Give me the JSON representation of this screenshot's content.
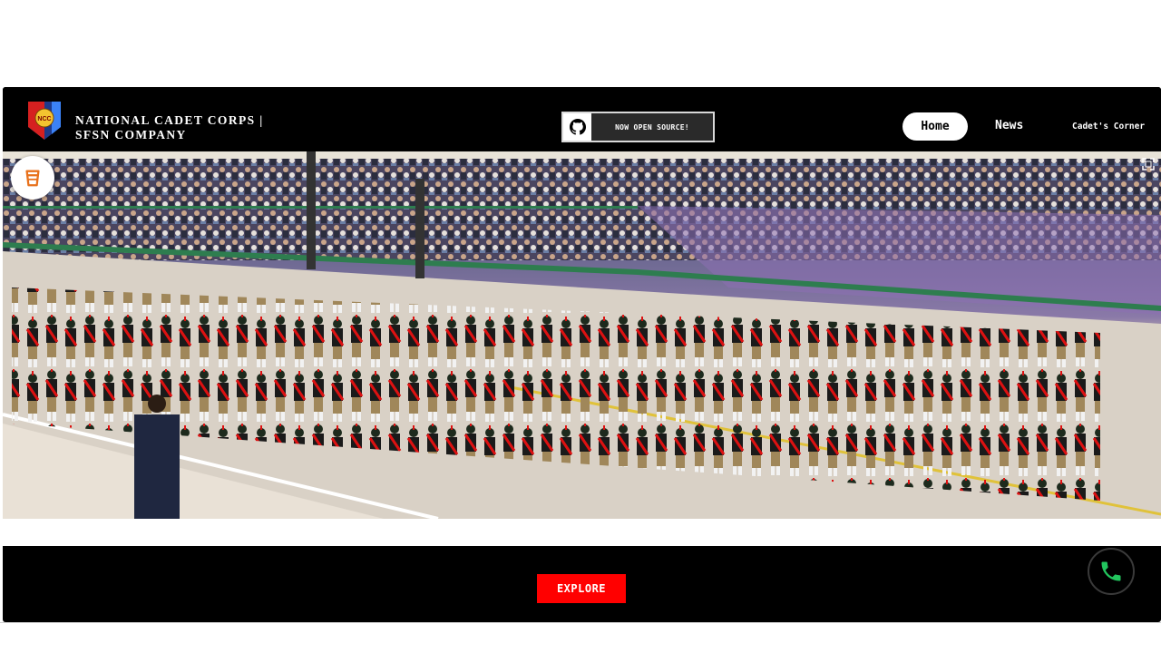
{
  "header": {
    "brand_line1": "NATIONAL CADET CORPS |",
    "brand_line2": "SFSN COMPANY",
    "logo_text": "NCC",
    "github_button_label": "Now Open Source!"
  },
  "nav": {
    "home": "Home",
    "news": "News",
    "cadets_corner": "Cadet's Corner"
  },
  "hero": {
    "image_alt": "NCC cadets marching in parade"
  },
  "cta": {
    "explore": "EXPLORE"
  },
  "colors": {
    "explore_bg": "#ff0000",
    "phone_icon": "#22c55e",
    "header_bg": "#000000"
  },
  "icons": [
    "github-icon",
    "cup-icon",
    "expand-icon",
    "phone-icon"
  ]
}
